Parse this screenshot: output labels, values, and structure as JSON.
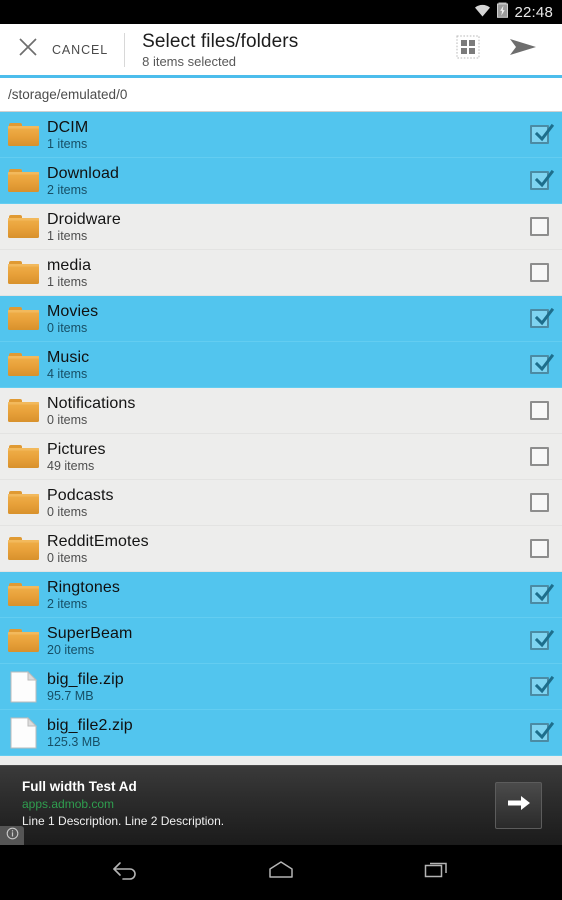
{
  "status_bar": {
    "time": "22:48",
    "wifi_icon": "wifi-icon",
    "battery_icon": "battery-charging-icon"
  },
  "toolbar": {
    "cancel_label": "CANCEL",
    "close_icon": "close-icon",
    "title": "Select files/folders",
    "subtitle": "8 items selected",
    "grid_view_icon": "grid-view-icon",
    "send_icon": "send-icon",
    "accent_color": "#4cbdec"
  },
  "path_bar": {
    "path": "/storage/emulated/0"
  },
  "selected_row_color": "#52c5ee",
  "list": {
    "items": [
      {
        "name": "DCIM",
        "meta": "1 items",
        "type": "folder",
        "selected": true
      },
      {
        "name": "Download",
        "meta": "2 items",
        "type": "folder",
        "selected": true
      },
      {
        "name": "Droidware",
        "meta": "1 items",
        "type": "folder",
        "selected": false
      },
      {
        "name": "media",
        "meta": "1 items",
        "type": "folder",
        "selected": false
      },
      {
        "name": "Movies",
        "meta": "0 items",
        "type": "folder",
        "selected": true
      },
      {
        "name": "Music",
        "meta": "4 items",
        "type": "folder",
        "selected": true
      },
      {
        "name": "Notifications",
        "meta": "0 items",
        "type": "folder",
        "selected": false
      },
      {
        "name": "Pictures",
        "meta": "49 items",
        "type": "folder",
        "selected": false
      },
      {
        "name": "Podcasts",
        "meta": "0 items",
        "type": "folder",
        "selected": false
      },
      {
        "name": "RedditEmotes",
        "meta": "0 items",
        "type": "folder",
        "selected": false
      },
      {
        "name": "Ringtones",
        "meta": "2 items",
        "type": "folder",
        "selected": true
      },
      {
        "name": "SuperBeam",
        "meta": "20 items",
        "type": "folder",
        "selected": true
      },
      {
        "name": "big_file.zip",
        "meta": "95.7 MB",
        "type": "file",
        "selected": true
      },
      {
        "name": "big_file2.zip",
        "meta": "125.3 MB",
        "type": "file",
        "selected": true
      }
    ]
  },
  "ad": {
    "title": "Full width Test Ad",
    "url": "apps.admob.com",
    "description": "Line 1 Description. Line 2 Description.",
    "cta_icon": "arrow-right-icon",
    "info_icon": "info-icon",
    "url_color": "#2f9e4f"
  },
  "nav_bar": {
    "back_icon": "back-icon",
    "home_icon": "home-icon",
    "recents_icon": "recents-icon"
  }
}
